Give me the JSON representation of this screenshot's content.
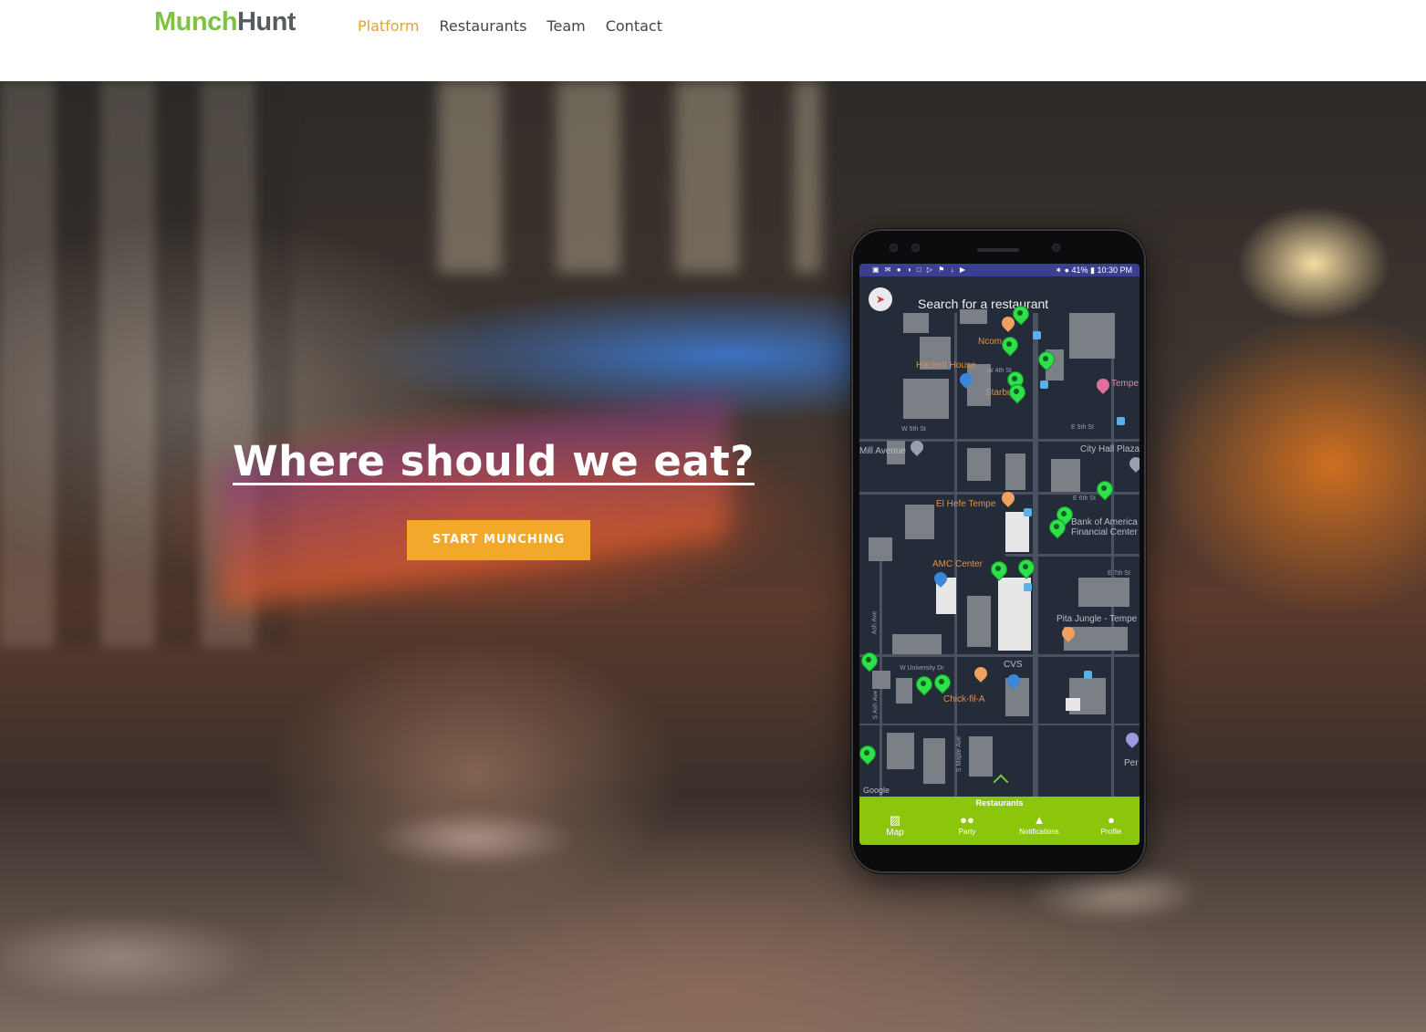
{
  "brand": {
    "part1": "Munch",
    "part2": "Hunt"
  },
  "nav": {
    "items": [
      {
        "label": "Platform",
        "active": true
      },
      {
        "label": "Restaurants",
        "active": false
      },
      {
        "label": "Team",
        "active": false
      },
      {
        "label": "Contact",
        "active": false
      }
    ]
  },
  "hero": {
    "headline": "Where should we eat?",
    "cta_label": "START MUNCHING"
  },
  "phone": {
    "status": {
      "icons": "▣ ✉ ● ◑ □ ▷ ⚑ ↓ ▶",
      "right": "✶ ● 41% ▮ 10:30 PM"
    },
    "search_placeholder": "Search for a restaurant",
    "map_labels": {
      "hackett_house": "Hackett House",
      "ncom": "Ncom",
      "starbucks": "Starbucks",
      "tempe_palms": "Tempe Palms",
      "mill_avenue": "Mill Avenue",
      "city_hall_plaza": "City Hall Plaza",
      "el_hefe": "El Hefe Tempe",
      "bank_of_america": "Bank of America Financial Center",
      "amc_center": "AMC Center",
      "pita_jungle": "Pita Jungle - Tempe",
      "cvs": "CVS",
      "chick_fil_a": "Chick-fil-A",
      "per": "Per",
      "w_5th": "W 5th St",
      "e_5th": "E 5th St",
      "e_6th": "E 6th St",
      "e_7th": "E 7th St",
      "w_univ": "W University Dr",
      "s_ash": "S Ash Ave",
      "s_maple": "S Maple Ave",
      "ash_ave": "Ash Ave",
      "w_4th": "W 4th St",
      "google": "Google"
    },
    "tabbar_title": "Restaurants",
    "tabs": [
      {
        "label": "Map",
        "icon": "map-icon",
        "glyph": "▨"
      },
      {
        "label": "Party",
        "icon": "party-icon",
        "glyph": "●●"
      },
      {
        "label": "Notifications",
        "icon": "bell-icon",
        "glyph": "▲"
      },
      {
        "label": "Profile",
        "icon": "profile-icon",
        "glyph": "●"
      }
    ]
  },
  "colors": {
    "brand_green": "#7dc242",
    "nav_active": "#e8a424",
    "cta": "#f2a82a",
    "tabbar": "#8cc60a"
  }
}
